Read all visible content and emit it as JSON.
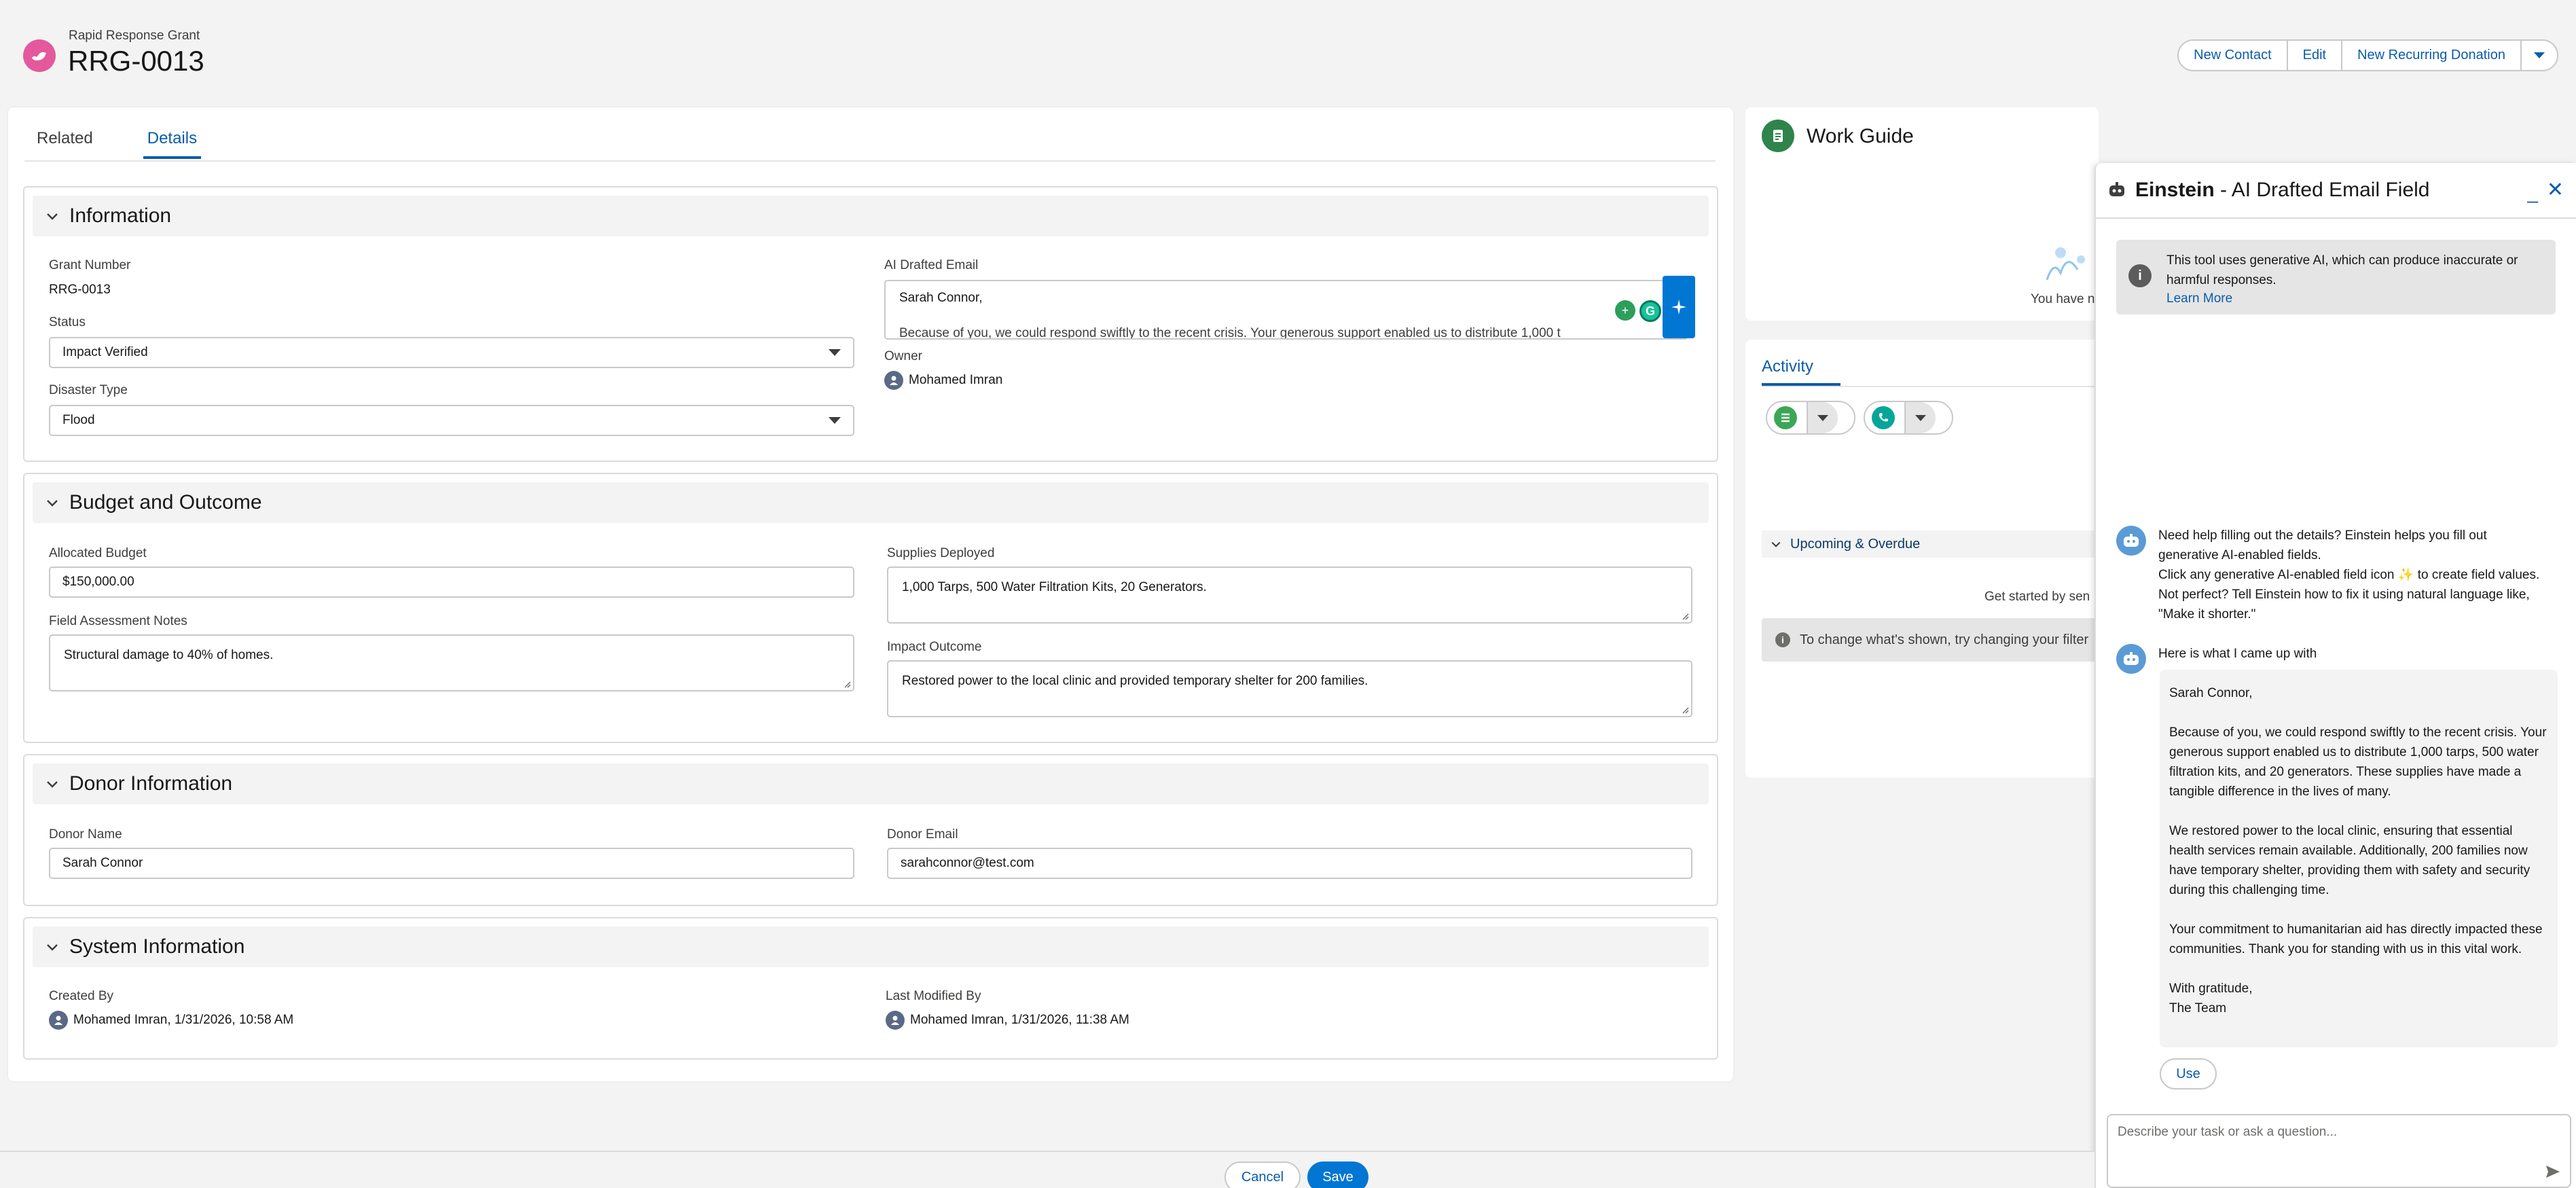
{
  "header": {
    "object_type": "Rapid Response Grant",
    "record_name": "RRG-0013",
    "actions": [
      "New Contact",
      "Edit",
      "New Recurring Donation"
    ]
  },
  "tabs": {
    "related": "Related",
    "details": "Details",
    "active": "Details"
  },
  "sections": {
    "information": {
      "title": "Information",
      "grant_number_label": "Grant Number",
      "grant_number": "RRG-0013",
      "status_label": "Status",
      "status": "Impact Verified",
      "disaster_type_label": "Disaster Type",
      "disaster_type": "Flood",
      "ai_email_label": "AI Drafted Email",
      "ai_email_value": "Sarah Connor,",
      "ai_email_second_line": "Because of you, we could respond swiftly to the recent crisis. Your generous support enabled us to distribute 1,000 t",
      "owner_label": "Owner",
      "owner": "Mohamed Imran"
    },
    "budget": {
      "title": "Budget and Outcome",
      "allocated_budget_label": "Allocated Budget",
      "allocated_budget": "$150,000.00",
      "field_notes_label": "Field Assessment Notes",
      "field_notes": "Structural damage to 40% of homes.",
      "supplies_label": "Supplies Deployed",
      "supplies": "1,000 Tarps, 500 Water Filtration Kits, 20 Generators.",
      "impact_label": "Impact Outcome",
      "impact": "Restored power to the local clinic and provided temporary shelter for 200 families."
    },
    "donor": {
      "title": "Donor Information",
      "name_label": "Donor Name",
      "name": "Sarah Connor",
      "email_label": "Donor Email",
      "email": "sarahconnor@test.com"
    },
    "system": {
      "title": "System Information",
      "created_label": "Created By",
      "created": "Mohamed Imran, 1/31/2026, 10:58 AM",
      "modified_label": "Last Modified By",
      "modified": "Mohamed Imran, 1/31/2026, 11:38 AM"
    }
  },
  "work_guide": {
    "title": "Work Guide",
    "empty_text": "You have no"
  },
  "activity": {
    "tab": "Activity",
    "upcoming": "Upcoming & Overdue",
    "get_started": "Get started by sen",
    "filter_hint": "To change what's shown, try changing your filter"
  },
  "einstein": {
    "title_bold": "Einstein",
    "title_rest": " - AI Drafted Email Field",
    "disclaimer": "This tool uses generative AI, which can produce inaccurate or harmful responses.",
    "learn_more": "Learn More",
    "intro_1": "Need help filling out the details? Einstein helps you fill out generative AI-enabled fields.",
    "intro_2a": "Click any generative AI-enabled field icon ",
    "intro_2b": " to create field values. Not perfect? Tell Einstein how to fix it using natural language like, \"Make it shorter.\"",
    "reply_intro": "Here is what I came up with",
    "draft": "Sarah Connor,\n\nBecause of you, we could respond swiftly to the recent crisis. Your generous support enabled us to distribute 1,000 tarps, 500 water filtration kits, and 20 generators. These supplies have made a tangible difference in the lives of many.\n\nWe restored power to the local clinic, ensuring that essential health services remain available. Additionally, 200 families now have temporary shelter, providing them with safety and security during this challenging time.\n\nYour commitment to humanitarian aid has directly impacted these communities. Thank you for standing with us in this vital work.\n\nWith gratitude,\nThe Team",
    "use_label": "Use",
    "ask_placeholder": "Describe your task or ask a question..."
  },
  "footer": {
    "cancel": "Cancel",
    "save": "Save"
  },
  "colors": {
    "brand_blue": "#0176d3",
    "link_blue": "#0b5cab",
    "record_icon": "#e3599c",
    "work_guide_icon": "#2e844a"
  }
}
